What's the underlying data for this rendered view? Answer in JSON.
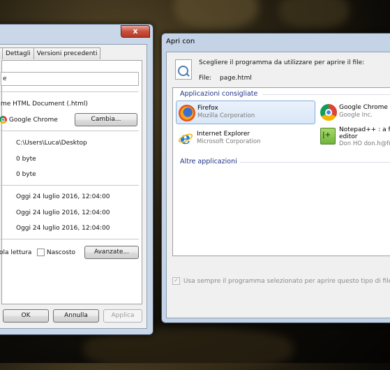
{
  "properties_window": {
    "close_label": "x",
    "tabs": [
      "Dettagli",
      "Versioni precedenti"
    ],
    "name_value": "e",
    "type_label": "me HTML Document (.html)",
    "open_with_app": "Google Chrome",
    "change_button": "Cambia...",
    "location": "C:\\Users\\Luca\\Desktop",
    "size": "0 byte",
    "size_on_disk": "0 byte",
    "created": "Oggi 24 luglio 2016, 12:04:00",
    "modified": "Oggi 24 luglio 2016, 12:04:00",
    "accessed": "Oggi 24 luglio 2016, 12:04:00",
    "readonly_label": "ola lettura",
    "hidden_label": "Nascosto",
    "advanced_button": "Avanzate...",
    "ok_button": "OK",
    "cancel_button": "Annulla",
    "apply_button": "Applica"
  },
  "open_with_window": {
    "title": "Apri con",
    "instruction": "Scegliere il programma da utilizzare per aprire il file:",
    "file_label": "File:",
    "file_name": "page.html",
    "recommended_header": "Applicazioni consigliate",
    "other_header": "Altre applicazioni",
    "apps": [
      {
        "name": "Firefox",
        "publisher": "Mozilla Corporation",
        "icon": "firefox-icon"
      },
      {
        "name": "Google Chrome",
        "publisher": "Google Inc.",
        "icon": "chrome-icon"
      },
      {
        "name": "Internet Explorer",
        "publisher": "Microsoft Corporation",
        "icon": "internet-explorer-icon"
      },
      {
        "name": "Notepad++ : a fr",
        "name_line2": "editor",
        "publisher": "Don HO don.h@fr",
        "icon": "notepad-plus-plus-icon"
      }
    ],
    "always_use_label": "Usa sempre il programma selezionato per aprire questo tipo di file"
  }
}
